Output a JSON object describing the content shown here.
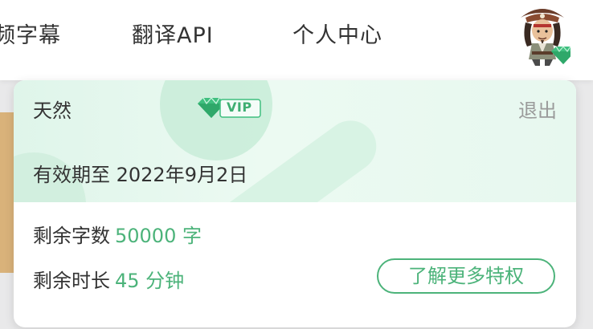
{
  "nav": {
    "items": [
      "频字幕",
      "翻译API",
      "个人中心"
    ]
  },
  "user_card": {
    "username": "天然",
    "vip_label": "VIP",
    "logout_label": "退出",
    "expiry_text": "有效期至 2022年9月2日",
    "remaining_words_label": "剩余字数",
    "remaining_words_value": "50000 字",
    "remaining_time_label": "剩余时长",
    "remaining_time_value": "45 分钟",
    "more_button_label": "了解更多特权"
  },
  "colors": {
    "accent": "#4cb37a",
    "card_top_bg": "#e4f7ed",
    "muted_text": "#9a9a9a",
    "side_strip": "#d9b27a"
  },
  "icons": {
    "avatar": "pirate-avatar-icon",
    "vip": "diamond-icon"
  }
}
